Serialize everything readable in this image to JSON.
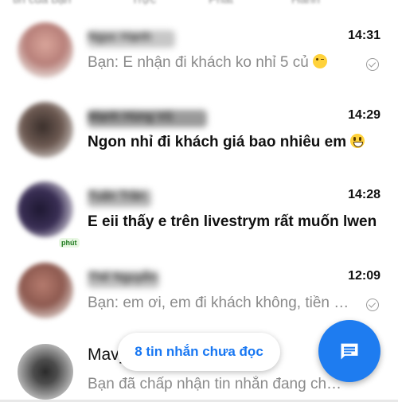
{
  "top_tabs": [
    "tin của bạn",
    "Trực",
    "Phát",
    "Hành"
  ],
  "conversations": [
    {
      "name": "Ngọc Hạnh",
      "time": "14:31",
      "preview": "Bạn: E nhận đi khách ko nhỉ 5 củ",
      "emoji": "wink-emoji",
      "unread": false,
      "read_status": "read-check-icon"
    },
    {
      "name": "Mạnh Hùng Vũ",
      "time": "14:29",
      "preview": "Ngon nhỉ đi khách giá bao nhiêu em",
      "emoji": "grin-emoji",
      "unread": true
    },
    {
      "name": "Tuấn Trần",
      "time": "14:28",
      "preview": "E eii thấy e trên livestrym rất muốn lwen",
      "badge": "phút",
      "unread": true
    },
    {
      "name": "Thế Nguyễn",
      "time": "12:09",
      "preview": "Bạn: em ơi, em đi khách không, tiền b...",
      "unread": false,
      "read_status": "read-check-icon"
    },
    {
      "name": "Mavy",
      "time": "",
      "preview": "Bạn đã chấp nhận tin nhắn đang chờ của...",
      "unread": false
    }
  ],
  "unread_pill": "8 tin nhắn chưa đọc",
  "fab_icon": "compose-message-icon",
  "colors": {
    "accent": "#1877f2",
    "fab": "#1e7cf0",
    "muted": "#8a8a8a"
  }
}
